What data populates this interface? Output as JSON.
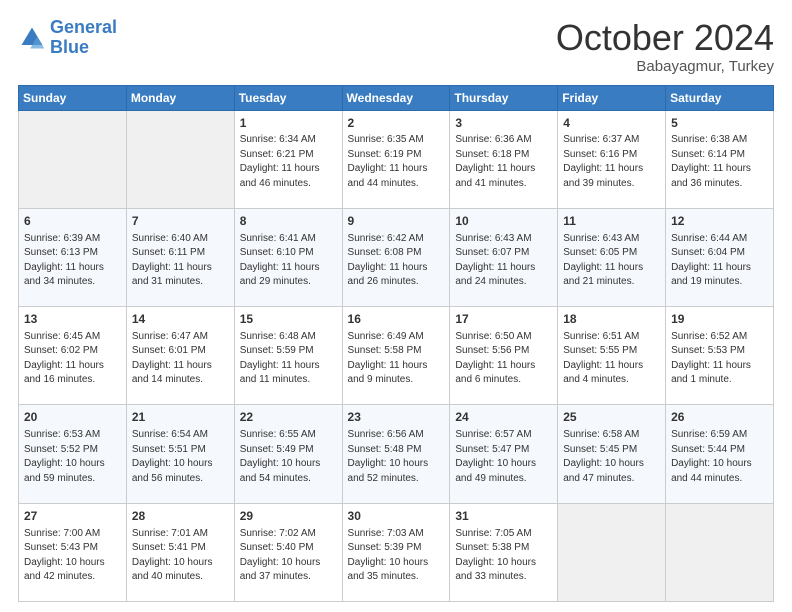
{
  "header": {
    "logo_line1": "General",
    "logo_line2": "Blue",
    "month": "October 2024",
    "location": "Babayagmur, Turkey"
  },
  "weekdays": [
    "Sunday",
    "Monday",
    "Tuesday",
    "Wednesday",
    "Thursday",
    "Friday",
    "Saturday"
  ],
  "weeks": [
    [
      {
        "day": "",
        "content": ""
      },
      {
        "day": "",
        "content": ""
      },
      {
        "day": "1",
        "content": "Sunrise: 6:34 AM\nSunset: 6:21 PM\nDaylight: 11 hours and 46 minutes."
      },
      {
        "day": "2",
        "content": "Sunrise: 6:35 AM\nSunset: 6:19 PM\nDaylight: 11 hours and 44 minutes."
      },
      {
        "day": "3",
        "content": "Sunrise: 6:36 AM\nSunset: 6:18 PM\nDaylight: 11 hours and 41 minutes."
      },
      {
        "day": "4",
        "content": "Sunrise: 6:37 AM\nSunset: 6:16 PM\nDaylight: 11 hours and 39 minutes."
      },
      {
        "day": "5",
        "content": "Sunrise: 6:38 AM\nSunset: 6:14 PM\nDaylight: 11 hours and 36 minutes."
      }
    ],
    [
      {
        "day": "6",
        "content": "Sunrise: 6:39 AM\nSunset: 6:13 PM\nDaylight: 11 hours and 34 minutes."
      },
      {
        "day": "7",
        "content": "Sunrise: 6:40 AM\nSunset: 6:11 PM\nDaylight: 11 hours and 31 minutes."
      },
      {
        "day": "8",
        "content": "Sunrise: 6:41 AM\nSunset: 6:10 PM\nDaylight: 11 hours and 29 minutes."
      },
      {
        "day": "9",
        "content": "Sunrise: 6:42 AM\nSunset: 6:08 PM\nDaylight: 11 hours and 26 minutes."
      },
      {
        "day": "10",
        "content": "Sunrise: 6:43 AM\nSunset: 6:07 PM\nDaylight: 11 hours and 24 minutes."
      },
      {
        "day": "11",
        "content": "Sunrise: 6:43 AM\nSunset: 6:05 PM\nDaylight: 11 hours and 21 minutes."
      },
      {
        "day": "12",
        "content": "Sunrise: 6:44 AM\nSunset: 6:04 PM\nDaylight: 11 hours and 19 minutes."
      }
    ],
    [
      {
        "day": "13",
        "content": "Sunrise: 6:45 AM\nSunset: 6:02 PM\nDaylight: 11 hours and 16 minutes."
      },
      {
        "day": "14",
        "content": "Sunrise: 6:47 AM\nSunset: 6:01 PM\nDaylight: 11 hours and 14 minutes."
      },
      {
        "day": "15",
        "content": "Sunrise: 6:48 AM\nSunset: 5:59 PM\nDaylight: 11 hours and 11 minutes."
      },
      {
        "day": "16",
        "content": "Sunrise: 6:49 AM\nSunset: 5:58 PM\nDaylight: 11 hours and 9 minutes."
      },
      {
        "day": "17",
        "content": "Sunrise: 6:50 AM\nSunset: 5:56 PM\nDaylight: 11 hours and 6 minutes."
      },
      {
        "day": "18",
        "content": "Sunrise: 6:51 AM\nSunset: 5:55 PM\nDaylight: 11 hours and 4 minutes."
      },
      {
        "day": "19",
        "content": "Sunrise: 6:52 AM\nSunset: 5:53 PM\nDaylight: 11 hours and 1 minute."
      }
    ],
    [
      {
        "day": "20",
        "content": "Sunrise: 6:53 AM\nSunset: 5:52 PM\nDaylight: 10 hours and 59 minutes."
      },
      {
        "day": "21",
        "content": "Sunrise: 6:54 AM\nSunset: 5:51 PM\nDaylight: 10 hours and 56 minutes."
      },
      {
        "day": "22",
        "content": "Sunrise: 6:55 AM\nSunset: 5:49 PM\nDaylight: 10 hours and 54 minutes."
      },
      {
        "day": "23",
        "content": "Sunrise: 6:56 AM\nSunset: 5:48 PM\nDaylight: 10 hours and 52 minutes."
      },
      {
        "day": "24",
        "content": "Sunrise: 6:57 AM\nSunset: 5:47 PM\nDaylight: 10 hours and 49 minutes."
      },
      {
        "day": "25",
        "content": "Sunrise: 6:58 AM\nSunset: 5:45 PM\nDaylight: 10 hours and 47 minutes."
      },
      {
        "day": "26",
        "content": "Sunrise: 6:59 AM\nSunset: 5:44 PM\nDaylight: 10 hours and 44 minutes."
      }
    ],
    [
      {
        "day": "27",
        "content": "Sunrise: 7:00 AM\nSunset: 5:43 PM\nDaylight: 10 hours and 42 minutes."
      },
      {
        "day": "28",
        "content": "Sunrise: 7:01 AM\nSunset: 5:41 PM\nDaylight: 10 hours and 40 minutes."
      },
      {
        "day": "29",
        "content": "Sunrise: 7:02 AM\nSunset: 5:40 PM\nDaylight: 10 hours and 37 minutes."
      },
      {
        "day": "30",
        "content": "Sunrise: 7:03 AM\nSunset: 5:39 PM\nDaylight: 10 hours and 35 minutes."
      },
      {
        "day": "31",
        "content": "Sunrise: 7:05 AM\nSunset: 5:38 PM\nDaylight: 10 hours and 33 minutes."
      },
      {
        "day": "",
        "content": ""
      },
      {
        "day": "",
        "content": ""
      }
    ]
  ]
}
